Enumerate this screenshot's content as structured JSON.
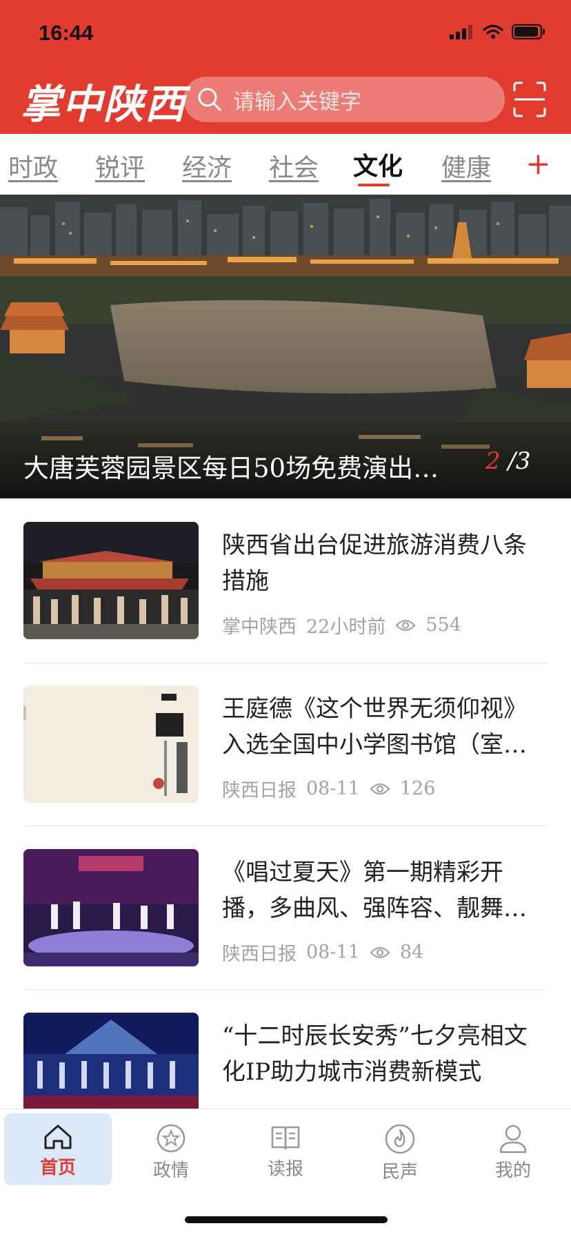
{
  "status": {
    "time": "16:44"
  },
  "header": {
    "logo": "掌中陕西",
    "search_placeholder": "请输入关键字",
    "accent": "#e23b30"
  },
  "tabs": [
    {
      "label": "时政",
      "active": false
    },
    {
      "label": "锐评",
      "active": false
    },
    {
      "label": "经济",
      "active": false
    },
    {
      "label": "社会",
      "active": false
    },
    {
      "label": "文化",
      "active": true
    },
    {
      "label": "健康",
      "active": false
    }
  ],
  "tabs_plus": "+",
  "hero": {
    "title": "大唐芙蓉园景区每日50场免费演出…",
    "current_page": "2",
    "total_pages": "/3"
  },
  "news": [
    {
      "title": "陕西省出台促进旅游消费八条措施",
      "source": "掌中陕西",
      "time": "22小时前",
      "views": "554"
    },
    {
      "title": "王庭德《这个世界无须仰视》入选全国中小学图书馆（室…",
      "source": "陕西日报",
      "time": "08-11",
      "views": "126"
    },
    {
      "title": "《唱过夏天》第一期精彩开播，多曲风、强阵容、靓舞…",
      "source": "陕西日报",
      "time": "08-11",
      "views": "84"
    },
    {
      "title": "“十二时辰长安秀”七夕亮相文化IP助力城市消费新模式",
      "source": "",
      "time": "",
      "views": ""
    }
  ],
  "tabbar": [
    {
      "label": "首页",
      "icon": "home-icon",
      "active": true
    },
    {
      "label": "政情",
      "icon": "star-badge-icon",
      "active": false
    },
    {
      "label": "读报",
      "icon": "book-icon",
      "active": false
    },
    {
      "label": "民声",
      "icon": "flame-icon",
      "active": false
    },
    {
      "label": "我的",
      "icon": "user-icon",
      "active": false
    }
  ]
}
